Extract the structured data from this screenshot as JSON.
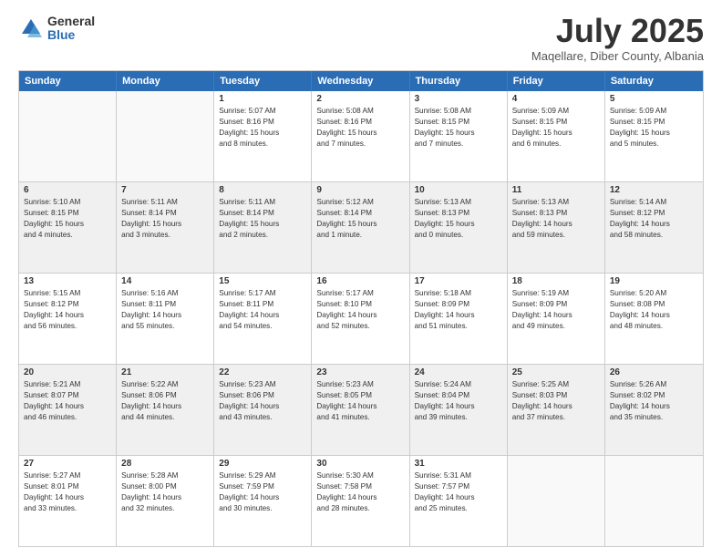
{
  "logo": {
    "general": "General",
    "blue": "Blue"
  },
  "title": "July 2025",
  "subtitle": "Maqellare, Diber County, Albania",
  "header_days": [
    "Sunday",
    "Monday",
    "Tuesday",
    "Wednesday",
    "Thursday",
    "Friday",
    "Saturday"
  ],
  "weeks": [
    [
      {
        "day": "",
        "lines": [],
        "empty": true
      },
      {
        "day": "",
        "lines": [],
        "empty": true
      },
      {
        "day": "1",
        "lines": [
          "Sunrise: 5:07 AM",
          "Sunset: 8:16 PM",
          "Daylight: 15 hours",
          "and 8 minutes."
        ]
      },
      {
        "day": "2",
        "lines": [
          "Sunrise: 5:08 AM",
          "Sunset: 8:16 PM",
          "Daylight: 15 hours",
          "and 7 minutes."
        ]
      },
      {
        "day": "3",
        "lines": [
          "Sunrise: 5:08 AM",
          "Sunset: 8:15 PM",
          "Daylight: 15 hours",
          "and 7 minutes."
        ]
      },
      {
        "day": "4",
        "lines": [
          "Sunrise: 5:09 AM",
          "Sunset: 8:15 PM",
          "Daylight: 15 hours",
          "and 6 minutes."
        ]
      },
      {
        "day": "5",
        "lines": [
          "Sunrise: 5:09 AM",
          "Sunset: 8:15 PM",
          "Daylight: 15 hours",
          "and 5 minutes."
        ]
      }
    ],
    [
      {
        "day": "6",
        "lines": [
          "Sunrise: 5:10 AM",
          "Sunset: 8:15 PM",
          "Daylight: 15 hours",
          "and 4 minutes."
        ]
      },
      {
        "day": "7",
        "lines": [
          "Sunrise: 5:11 AM",
          "Sunset: 8:14 PM",
          "Daylight: 15 hours",
          "and 3 minutes."
        ]
      },
      {
        "day": "8",
        "lines": [
          "Sunrise: 5:11 AM",
          "Sunset: 8:14 PM",
          "Daylight: 15 hours",
          "and 2 minutes."
        ]
      },
      {
        "day": "9",
        "lines": [
          "Sunrise: 5:12 AM",
          "Sunset: 8:14 PM",
          "Daylight: 15 hours",
          "and 1 minute."
        ]
      },
      {
        "day": "10",
        "lines": [
          "Sunrise: 5:13 AM",
          "Sunset: 8:13 PM",
          "Daylight: 15 hours",
          "and 0 minutes."
        ]
      },
      {
        "day": "11",
        "lines": [
          "Sunrise: 5:13 AM",
          "Sunset: 8:13 PM",
          "Daylight: 14 hours",
          "and 59 minutes."
        ]
      },
      {
        "day": "12",
        "lines": [
          "Sunrise: 5:14 AM",
          "Sunset: 8:12 PM",
          "Daylight: 14 hours",
          "and 58 minutes."
        ]
      }
    ],
    [
      {
        "day": "13",
        "lines": [
          "Sunrise: 5:15 AM",
          "Sunset: 8:12 PM",
          "Daylight: 14 hours",
          "and 56 minutes."
        ]
      },
      {
        "day": "14",
        "lines": [
          "Sunrise: 5:16 AM",
          "Sunset: 8:11 PM",
          "Daylight: 14 hours",
          "and 55 minutes."
        ]
      },
      {
        "day": "15",
        "lines": [
          "Sunrise: 5:17 AM",
          "Sunset: 8:11 PM",
          "Daylight: 14 hours",
          "and 54 minutes."
        ]
      },
      {
        "day": "16",
        "lines": [
          "Sunrise: 5:17 AM",
          "Sunset: 8:10 PM",
          "Daylight: 14 hours",
          "and 52 minutes."
        ]
      },
      {
        "day": "17",
        "lines": [
          "Sunrise: 5:18 AM",
          "Sunset: 8:09 PM",
          "Daylight: 14 hours",
          "and 51 minutes."
        ]
      },
      {
        "day": "18",
        "lines": [
          "Sunrise: 5:19 AM",
          "Sunset: 8:09 PM",
          "Daylight: 14 hours",
          "and 49 minutes."
        ]
      },
      {
        "day": "19",
        "lines": [
          "Sunrise: 5:20 AM",
          "Sunset: 8:08 PM",
          "Daylight: 14 hours",
          "and 48 minutes."
        ]
      }
    ],
    [
      {
        "day": "20",
        "lines": [
          "Sunrise: 5:21 AM",
          "Sunset: 8:07 PM",
          "Daylight: 14 hours",
          "and 46 minutes."
        ]
      },
      {
        "day": "21",
        "lines": [
          "Sunrise: 5:22 AM",
          "Sunset: 8:06 PM",
          "Daylight: 14 hours",
          "and 44 minutes."
        ]
      },
      {
        "day": "22",
        "lines": [
          "Sunrise: 5:23 AM",
          "Sunset: 8:06 PM",
          "Daylight: 14 hours",
          "and 43 minutes."
        ]
      },
      {
        "day": "23",
        "lines": [
          "Sunrise: 5:23 AM",
          "Sunset: 8:05 PM",
          "Daylight: 14 hours",
          "and 41 minutes."
        ]
      },
      {
        "day": "24",
        "lines": [
          "Sunrise: 5:24 AM",
          "Sunset: 8:04 PM",
          "Daylight: 14 hours",
          "and 39 minutes."
        ]
      },
      {
        "day": "25",
        "lines": [
          "Sunrise: 5:25 AM",
          "Sunset: 8:03 PM",
          "Daylight: 14 hours",
          "and 37 minutes."
        ]
      },
      {
        "day": "26",
        "lines": [
          "Sunrise: 5:26 AM",
          "Sunset: 8:02 PM",
          "Daylight: 14 hours",
          "and 35 minutes."
        ]
      }
    ],
    [
      {
        "day": "27",
        "lines": [
          "Sunrise: 5:27 AM",
          "Sunset: 8:01 PM",
          "Daylight: 14 hours",
          "and 33 minutes."
        ]
      },
      {
        "day": "28",
        "lines": [
          "Sunrise: 5:28 AM",
          "Sunset: 8:00 PM",
          "Daylight: 14 hours",
          "and 32 minutes."
        ]
      },
      {
        "day": "29",
        "lines": [
          "Sunrise: 5:29 AM",
          "Sunset: 7:59 PM",
          "Daylight: 14 hours",
          "and 30 minutes."
        ]
      },
      {
        "day": "30",
        "lines": [
          "Sunrise: 5:30 AM",
          "Sunset: 7:58 PM",
          "Daylight: 14 hours",
          "and 28 minutes."
        ]
      },
      {
        "day": "31",
        "lines": [
          "Sunrise: 5:31 AM",
          "Sunset: 7:57 PM",
          "Daylight: 14 hours",
          "and 25 minutes."
        ]
      },
      {
        "day": "",
        "lines": [],
        "empty": true
      },
      {
        "day": "",
        "lines": [],
        "empty": true
      }
    ]
  ]
}
